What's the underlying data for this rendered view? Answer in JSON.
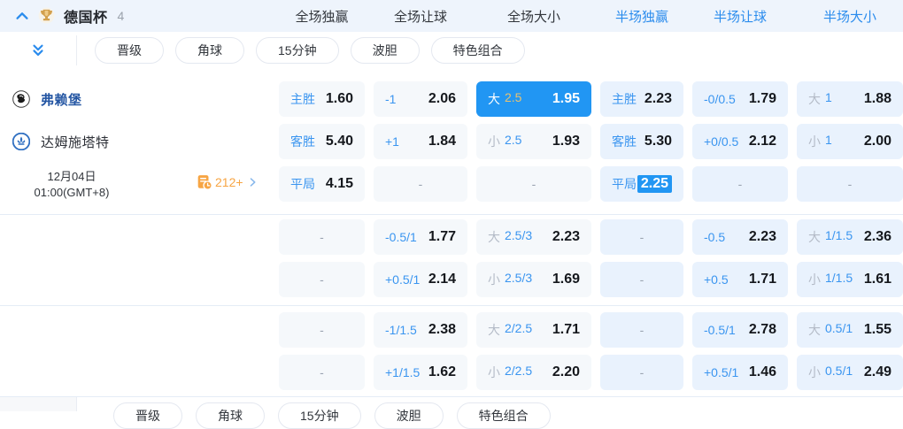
{
  "header": {
    "league": "德国杯",
    "count": "4",
    "tabs": [
      {
        "label": "全场独赢",
        "highlighted": false
      },
      {
        "label": "全场让球",
        "highlighted": false
      },
      {
        "label": "全场大小",
        "highlighted": false
      },
      {
        "label": "半场独赢",
        "highlighted": true
      },
      {
        "label": "半场让球",
        "highlighted": true
      },
      {
        "label": "半场大小",
        "highlighted": true
      }
    ]
  },
  "subbar": {
    "pills": [
      "晋级",
      "角球",
      "15分钟",
      "波胆",
      "特色组合"
    ]
  },
  "match": {
    "home": "弗赖堡",
    "away": "达姆施塔特",
    "date_line1": "12月04日",
    "date_line2": "01:00(GMT+8)",
    "more_count": "212+"
  },
  "empty_placeholder": "-",
  "odds_rows": [
    [
      {
        "t": "label",
        "label": "主胜",
        "odds": "1.60"
      },
      {
        "t": "label",
        "label": "-1",
        "odds": "2.06"
      },
      {
        "t": "ou",
        "side": "大",
        "line": "2.5",
        "odds": "1.95",
        "selected": true
      },
      {
        "t": "label",
        "label": "主胜",
        "odds": "2.23"
      },
      {
        "t": "label",
        "label": "-0/0.5",
        "odds": "1.79"
      },
      {
        "t": "ou",
        "side": "大",
        "line": "1",
        "odds": "1.88"
      }
    ],
    [
      {
        "t": "label",
        "label": "客胜",
        "odds": "5.40"
      },
      {
        "t": "label",
        "label": "+1",
        "odds": "1.84"
      },
      {
        "t": "ou",
        "side": "小",
        "line": "2.5",
        "odds": "1.93"
      },
      {
        "t": "label",
        "label": "客胜",
        "odds": "5.30"
      },
      {
        "t": "label",
        "label": "+0/0.5",
        "odds": "2.12"
      },
      {
        "t": "ou",
        "side": "小",
        "line": "1",
        "odds": "2.00"
      }
    ],
    [
      {
        "t": "label",
        "label": "平局",
        "odds": "4.15"
      },
      {
        "t": "dash"
      },
      {
        "t": "dash"
      },
      {
        "t": "label",
        "label": "平局",
        "odds": "2.25",
        "hl": true
      },
      {
        "t": "dash"
      },
      {
        "t": "dash"
      }
    ],
    [
      {
        "t": "dash"
      },
      {
        "t": "label",
        "label": "-0.5/1",
        "odds": "1.77"
      },
      {
        "t": "ou",
        "side": "大",
        "line": "2.5/3",
        "odds": "2.23"
      },
      {
        "t": "dash"
      },
      {
        "t": "label",
        "label": "-0.5",
        "odds": "2.23"
      },
      {
        "t": "ou",
        "side": "大",
        "line": "1/1.5",
        "odds": "2.36"
      }
    ],
    [
      {
        "t": "dash"
      },
      {
        "t": "label",
        "label": "+0.5/1",
        "odds": "2.14"
      },
      {
        "t": "ou",
        "side": "小",
        "line": "2.5/3",
        "odds": "1.69"
      },
      {
        "t": "dash"
      },
      {
        "t": "label",
        "label": "+0.5",
        "odds": "1.71"
      },
      {
        "t": "ou",
        "side": "小",
        "line": "1/1.5",
        "odds": "1.61"
      }
    ],
    [
      {
        "t": "dash"
      },
      {
        "t": "label",
        "label": "-1/1.5",
        "odds": "2.38"
      },
      {
        "t": "ou",
        "side": "大",
        "line": "2/2.5",
        "odds": "1.71"
      },
      {
        "t": "dash"
      },
      {
        "t": "label",
        "label": "-0.5/1",
        "odds": "2.78"
      },
      {
        "t": "ou",
        "side": "大",
        "line": "0.5/1",
        "odds": "1.55"
      }
    ],
    [
      {
        "t": "dash"
      },
      {
        "t": "label",
        "label": "+1/1.5",
        "odds": "1.62"
      },
      {
        "t": "ou",
        "side": "小",
        "line": "2/2.5",
        "odds": "2.20"
      },
      {
        "t": "dash"
      },
      {
        "t": "label",
        "label": "+0.5/1",
        "odds": "1.46"
      },
      {
        "t": "ou",
        "side": "小",
        "line": "0.5/1",
        "odds": "2.49"
      }
    ]
  ],
  "colors": {
    "accent_blue": "#2196f3",
    "tab_blue": "#2b8ced",
    "label_blue": "#3a95f0",
    "line_gold_selected": "#e8c271",
    "cell_gray_bg": "#f5f8fb",
    "cell_blue_bg": "#e9f2fd",
    "topbar_bg": "#eef4fc",
    "orange": "#f7a544",
    "home_team_blue": "#2456a3",
    "odds_text": "#15181d"
  }
}
